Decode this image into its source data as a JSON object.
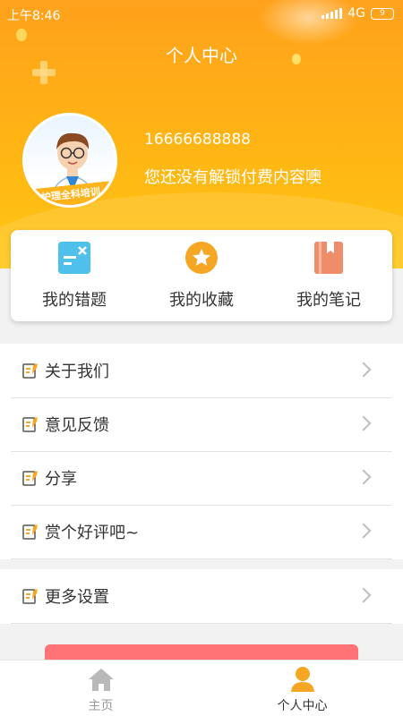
{
  "status_bar": {
    "time": "上午8:46",
    "network": "4G",
    "battery": "9"
  },
  "header": {
    "title": "个人中心",
    "phone": "16666688888",
    "tip": "您还没有解锁付费内容噢",
    "avatar_text": "护理全科培训"
  },
  "quick_actions": [
    {
      "label": "我的错题",
      "icon": "wrong-questions-icon",
      "color": "#4fc0ea"
    },
    {
      "label": "我的收藏",
      "icon": "star-icon",
      "color": "#f5a623"
    },
    {
      "label": "我的笔记",
      "icon": "notebook-icon",
      "color": "#ef8c6a"
    }
  ],
  "menu": [
    {
      "label": "关于我们"
    },
    {
      "label": "意见反馈"
    },
    {
      "label": "分享"
    },
    {
      "label": "赏个好评吧~"
    }
  ],
  "menu2": [
    {
      "label": "更多设置"
    }
  ],
  "tabs": [
    {
      "label": "主页",
      "active": false
    },
    {
      "label": "个人中心",
      "active": true
    }
  ],
  "colors": {
    "accent": "#ffa11c",
    "tab_active": "#f5a623",
    "tab_inactive": "#999999",
    "logout": "#ff7275"
  }
}
